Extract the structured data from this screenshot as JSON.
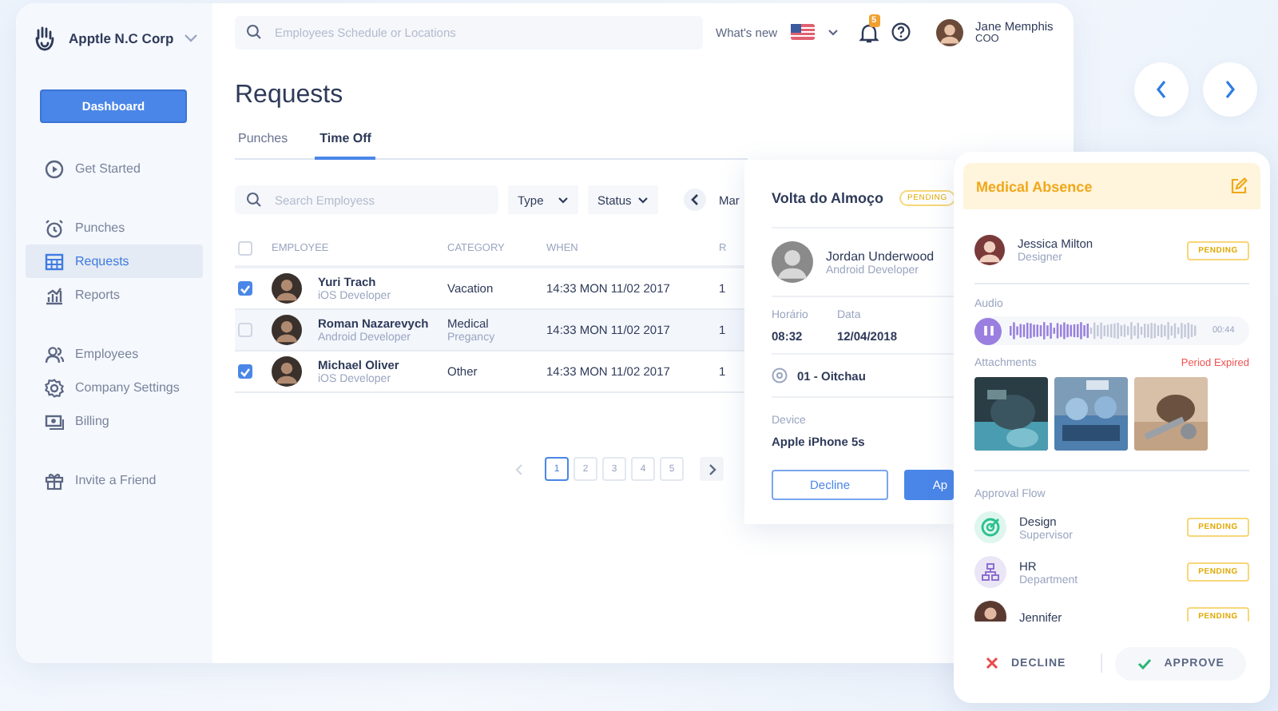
{
  "sidebar": {
    "company": "Apptle N.C Corp",
    "button": "Dashboard",
    "groups": [
      {
        "items": [
          {
            "label": "Get Started",
            "selected": false
          }
        ]
      },
      {
        "items": [
          {
            "label": "Punches",
            "selected": false
          },
          {
            "label": "Requests",
            "selected": true
          },
          {
            "label": "Reports",
            "selected": false
          }
        ]
      },
      {
        "items": [
          {
            "label": "Employees",
            "selected": false
          },
          {
            "label": "Company Settings",
            "selected": false
          },
          {
            "label": "Billing",
            "selected": false
          }
        ]
      },
      {
        "items": [
          {
            "label": "Invite a Friend",
            "selected": false
          }
        ]
      }
    ]
  },
  "topbar": {
    "search_placeholder": "Employees Schedule or Locations",
    "whats_new": "What's new",
    "notifications": "5",
    "user": {
      "name": "Jane Memphis",
      "role": "COO"
    }
  },
  "page": {
    "title": "Requests",
    "tabs": [
      {
        "label": "Punches",
        "selected": false
      },
      {
        "label": "Time Off",
        "selected": true
      }
    ]
  },
  "filters": {
    "search_placeholder": "Search Employess",
    "dropdowns": [
      "Type",
      "Status"
    ],
    "month": "Mar"
  },
  "table": {
    "all_checked": false,
    "columns": [
      "EMPLOYEE",
      "CATEGORY",
      "WHEN",
      "R"
    ],
    "rows": [
      {
        "checked": true,
        "selected": false,
        "name": "Yuri Trach",
        "role": "iOS Developer",
        "category": "Vacation",
        "when": "14:33 MON 11/02 2017",
        "column_4": "1"
      },
      {
        "checked": false,
        "selected": true,
        "name": "Roman Nazarevych",
        "role": "Android Developer",
        "category": "Medical",
        "category_detail": "Pregancy",
        "when": "14:33 MON 11/02 2017",
        "column_4": "1"
      },
      {
        "checked": true,
        "selected": false,
        "name": "Michael Oliver",
        "role": "iOS Developer",
        "category": "Other",
        "when": "14:33 MON 11/02 2017",
        "column_4": "1"
      }
    ]
  },
  "pagination": {
    "pages": [
      {
        "label": "1",
        "selected": true
      },
      {
        "label": "2",
        "selected": false
      },
      {
        "label": "3",
        "selected": false
      },
      {
        "label": "4",
        "selected": false
      },
      {
        "label": "5",
        "selected": false
      }
    ]
  },
  "punch_card": {
    "title": "Volta do Almoço",
    "status": "PENDING",
    "person": {
      "name": "Jordan Underwood",
      "role": "Android Developer"
    },
    "fields": [
      {
        "label": "Horário",
        "value": "08:32"
      },
      {
        "label": "Data",
        "value": "12/04/2018"
      }
    ],
    "location": "01 - Oitchau",
    "device_label": "Device",
    "device": "Apple iPhone 5s",
    "buttons": [
      "Decline",
      "Ap"
    ]
  },
  "absence_card": {
    "title": "Medical Absence",
    "person": {
      "name": "Jessica Milton",
      "role": "Designer",
      "status": "PENDING"
    },
    "audio_label": "Audio",
    "audio": {
      "level": 0.42,
      "time": "00:44",
      "playing": true
    },
    "attachments_label": "Attachments",
    "attachments_note": "Period Expired",
    "approval_label": "Approval Flow",
    "approvals": [
      {
        "kind": "team",
        "name": "Design",
        "detail": "Supervisor",
        "status": "PENDING"
      },
      {
        "kind": "team",
        "name": "HR",
        "detail": "Department",
        "status": "PENDING"
      },
      {
        "kind": "person",
        "name": "Jennifer",
        "status": "PENDING"
      }
    ],
    "actions": {
      "decline": "DECLINE",
      "approve": "APPROVE"
    }
  }
}
